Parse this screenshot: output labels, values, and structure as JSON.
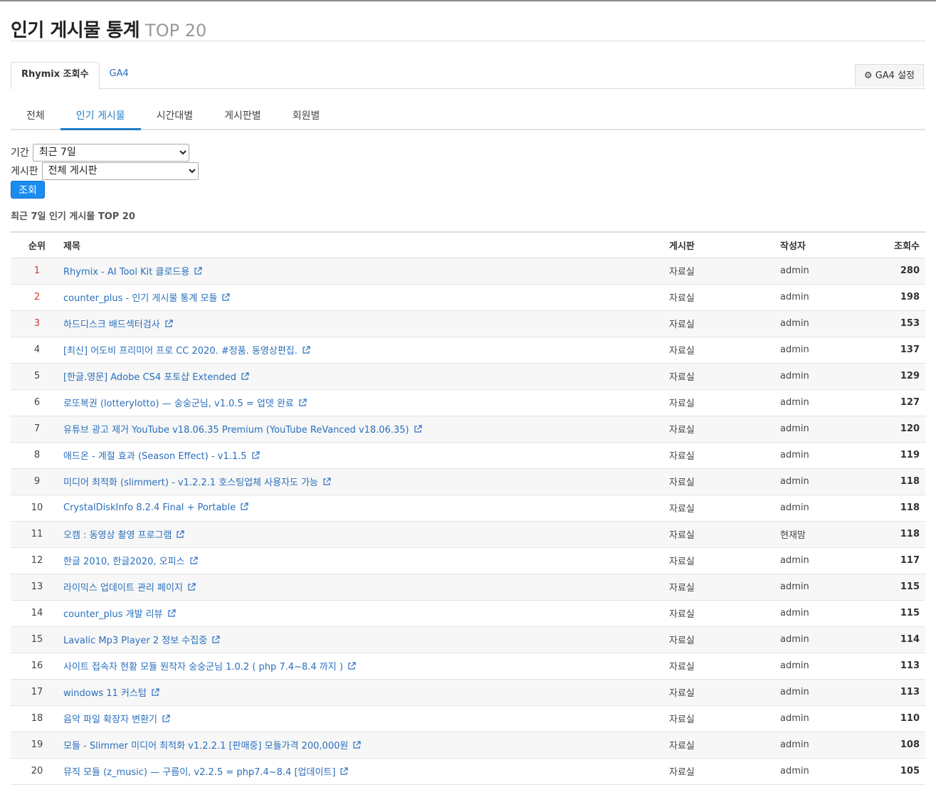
{
  "header": {
    "title": "인기 게시물 통계",
    "subtitle": "TOP 20"
  },
  "top_tabs": [
    {
      "label": "Rhymix 조회수",
      "active": true
    },
    {
      "label": "GA4",
      "active": false
    }
  ],
  "ga4_settings_label": "GA4 설정",
  "ga4_settings_icon": "gear-icon",
  "sub_tabs": [
    {
      "label": "전체",
      "active": false
    },
    {
      "label": "인기 게시물",
      "active": true
    },
    {
      "label": "시간대별",
      "active": false
    },
    {
      "label": "게시판별",
      "active": false
    },
    {
      "label": "회원별",
      "active": false
    }
  ],
  "filter": {
    "period_label": "기간",
    "period_value": "최근 7일",
    "board_label": "게시판",
    "board_value": "전체 게시판",
    "search_label": "조회"
  },
  "caption": "최근 7일 인기 게시물 TOP 20",
  "table": {
    "headers": {
      "rank": "순위",
      "title": "제목",
      "board": "게시판",
      "author": "작성자",
      "views": "조회수"
    },
    "rows": [
      {
        "rank": "1",
        "title": "Rhymix - AI Tool Kit 클로드용",
        "board": "자료실",
        "author": "admin",
        "views": "280"
      },
      {
        "rank": "2",
        "title": "counter_plus - 인기 게시물 통계 모듈",
        "board": "자료실",
        "author": "admin",
        "views": "198"
      },
      {
        "rank": "3",
        "title": "하드디스크 배드섹터검사",
        "board": "자료실",
        "author": "admin",
        "views": "153"
      },
      {
        "rank": "4",
        "title": "[최신] 어도비 프리미어 프로 CC 2020. #정품. 동영상편집.",
        "board": "자료실",
        "author": "admin",
        "views": "137"
      },
      {
        "rank": "5",
        "title": "[한글.영문] Adobe CS4 포토샵 Extended",
        "board": "자료실",
        "author": "admin",
        "views": "129"
      },
      {
        "rank": "6",
        "title": "로또복권 (lotterylotto) — 숭숭군님, v1.0.5 = 업뎃 완료",
        "board": "자료실",
        "author": "admin",
        "views": "127"
      },
      {
        "rank": "7",
        "title": "유튜브 광고 제거 YouTube v18.06.35 Premium (YouTube ReVanced v18.06.35)",
        "board": "자료실",
        "author": "admin",
        "views": "120"
      },
      {
        "rank": "8",
        "title": "애드온 - 계절 효과 (Season Effect) - v1.1.5",
        "board": "자료실",
        "author": "admin",
        "views": "119"
      },
      {
        "rank": "9",
        "title": "미디어 최적화 (slimmert) - v1.2.2.1 호스팅업체 사용자도 가능",
        "board": "자료실",
        "author": "admin",
        "views": "118"
      },
      {
        "rank": "10",
        "title": "CrystalDiskInfo 8.2.4 Final + Portable",
        "board": "자료실",
        "author": "admin",
        "views": "118"
      },
      {
        "rank": "11",
        "title": "오캠 : 동영상 촬영 프로그램",
        "board": "자료실",
        "author": "현재맘",
        "views": "118"
      },
      {
        "rank": "12",
        "title": "한글 2010, 한글2020, 오피스",
        "board": "자료실",
        "author": "admin",
        "views": "117"
      },
      {
        "rank": "13",
        "title": "라이믹스 업데이트 관리 페이지",
        "board": "자료실",
        "author": "admin",
        "views": "115"
      },
      {
        "rank": "14",
        "title": "counter_plus 개발 리뷰",
        "board": "자료실",
        "author": "admin",
        "views": "115"
      },
      {
        "rank": "15",
        "title": "Lavalic Mp3 Player 2 정보 수집중",
        "board": "자료실",
        "author": "admin",
        "views": "114"
      },
      {
        "rank": "16",
        "title": "사이트 접속자 현황 모듈 원작자 숭숭군님 1.0.2 ( php 7.4~8.4 까지 )",
        "board": "자료실",
        "author": "admin",
        "views": "113"
      },
      {
        "rank": "17",
        "title": "windows 11 커스텀",
        "board": "자료실",
        "author": "admin",
        "views": "113"
      },
      {
        "rank": "18",
        "title": "음악 파일 확장자 변환기",
        "board": "자료실",
        "author": "admin",
        "views": "110"
      },
      {
        "rank": "19",
        "title": "모듈 - Slimmer 미디어 최적화 v1.2.2.1 [판매중] 모듈가격 200,000원",
        "board": "자료실",
        "author": "admin",
        "views": "108"
      },
      {
        "rank": "20",
        "title": "뮤직 모듈 (z_music) — 구름이, v2.2.5 = php7.4~8.4 [업데이트]",
        "board": "자료실",
        "author": "admin",
        "views": "105"
      }
    ]
  },
  "colors": {
    "link": "#2a6fbd",
    "top_rank": "#d9362b",
    "primary_button": "#1a8cf0",
    "active_subtab": "#1f7ecb"
  }
}
